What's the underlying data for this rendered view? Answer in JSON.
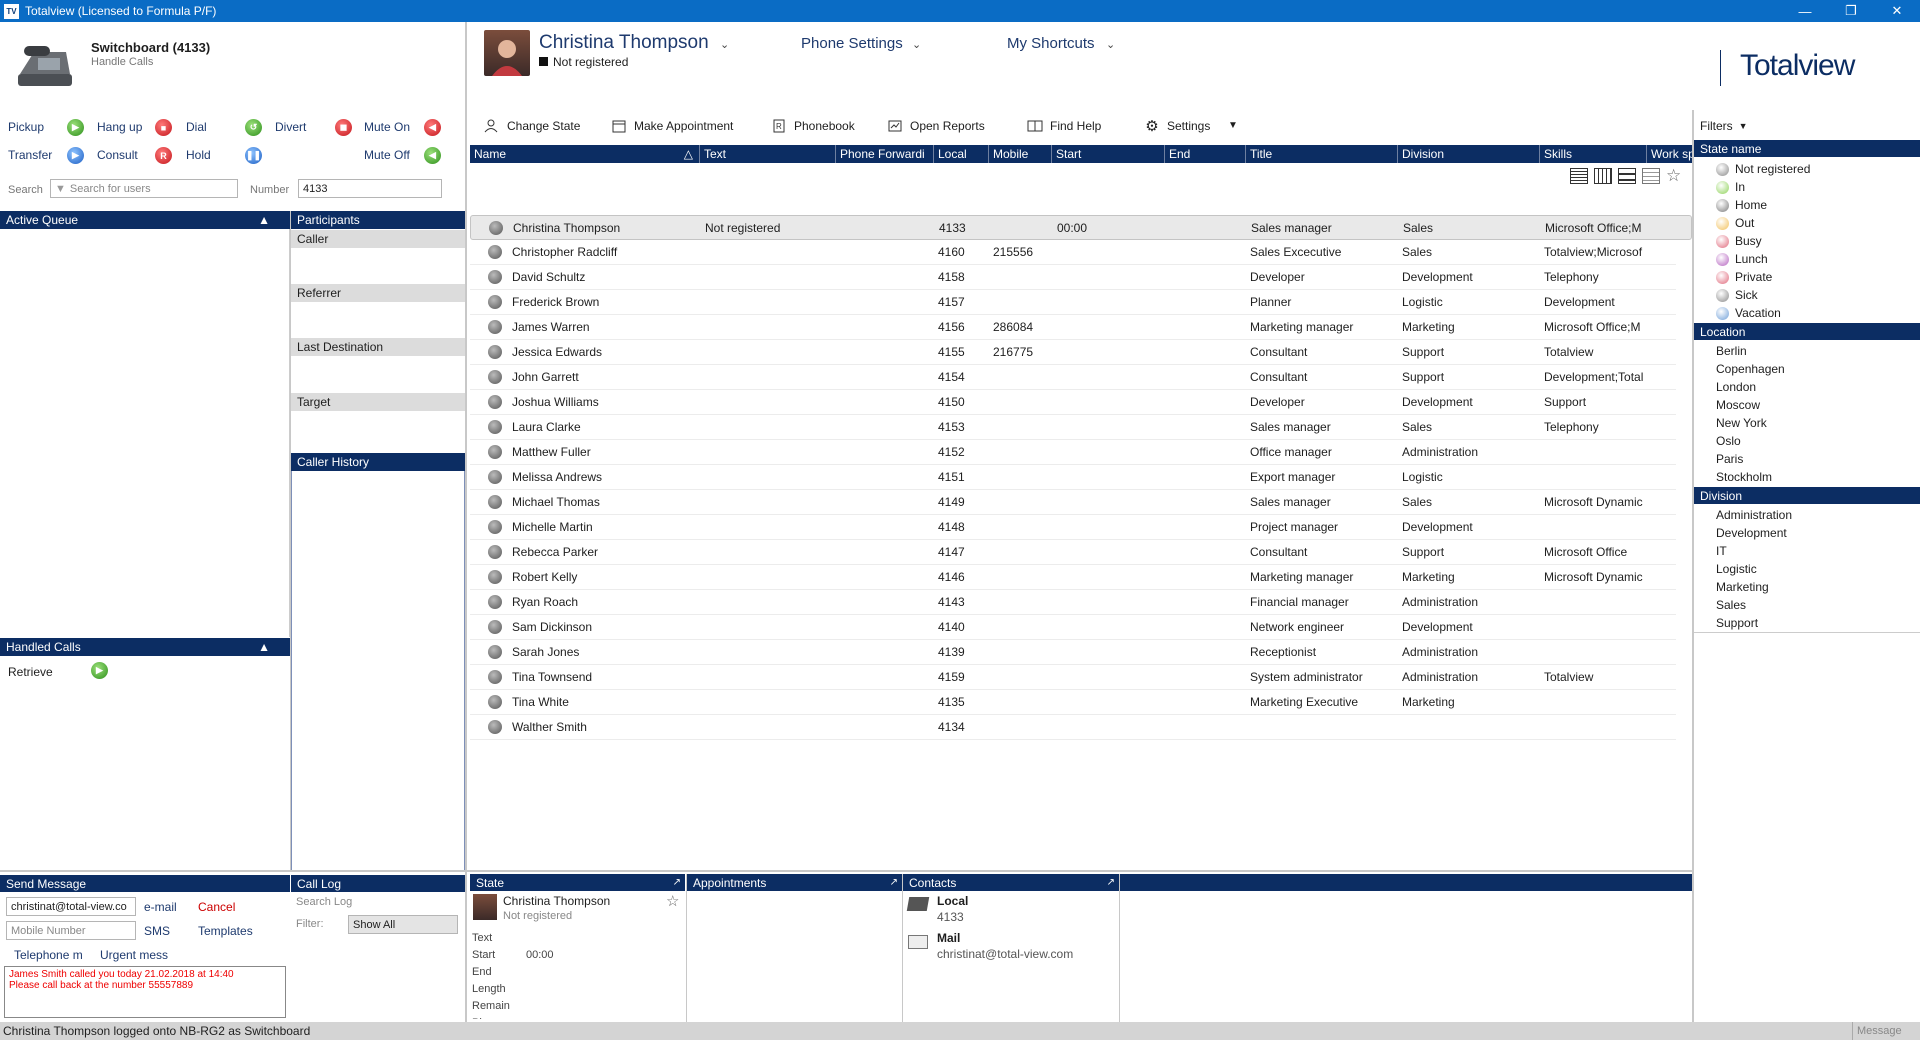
{
  "window": {
    "title": "Totalview  (Licensed to Formula P/F)",
    "app_badge": "TV"
  },
  "switchboard": {
    "title": "Switchboard (4133)",
    "subtitle": "Handle Calls"
  },
  "controls": {
    "pickup": "Pickup",
    "hangup": "Hang up",
    "dial": "Dial",
    "divert": "Divert",
    "mute_on": "Mute On",
    "transfer": "Transfer",
    "consult": "Consult",
    "hold": "Hold",
    "mute_off": "Mute Off"
  },
  "search": {
    "label": "Search",
    "placeholder": "Search for users",
    "number_label": "Number",
    "number_value": "4133"
  },
  "queue": {
    "active_queue": "Active Queue",
    "handled_calls": "Handled Calls",
    "retrieve": "Retrieve"
  },
  "participants": {
    "header": "Participants",
    "caller": "Caller",
    "referrer": "Referrer",
    "last_destination": "Last Destination",
    "target": "Target",
    "caller_history": "Caller History"
  },
  "header": {
    "user_name": "Christina Thompson",
    "user_status": "Not registered",
    "phone_settings": "Phone Settings",
    "my_shortcuts": "My Shortcuts",
    "logo": "Totalview"
  },
  "toolbar": {
    "change_state": "Change State",
    "make_appointment": "Make Appointment",
    "phonebook": "Phonebook",
    "open_reports": "Open Reports",
    "find_help": "Find Help",
    "settings": "Settings"
  },
  "table": {
    "columns": [
      "Name",
      "Text",
      "Phone Forwardi",
      "Local",
      "Mobile",
      "Start",
      "End",
      "Title",
      "Division",
      "Skills",
      "Work sp"
    ],
    "rows": [
      {
        "name": "Christina Thompson",
        "text": "Not registered",
        "local": "4133",
        "mobile": "",
        "start": "00:00",
        "title": "Sales manager",
        "division": "Sales",
        "skills": "Microsoft Office;M"
      },
      {
        "name": "Christopher Radcliff",
        "text": "",
        "local": "4160",
        "mobile": "215556",
        "start": "",
        "title": "Sales Excecutive",
        "division": "Sales",
        "skills": "Totalview;Microsof"
      },
      {
        "name": "David Schultz",
        "text": "",
        "local": "4158",
        "mobile": "",
        "start": "",
        "title": "Developer",
        "division": "Development",
        "skills": "Telephony"
      },
      {
        "name": "Frederick Brown",
        "text": "",
        "local": "4157",
        "mobile": "",
        "start": "",
        "title": "Planner",
        "division": "Logistic",
        "skills": "Development"
      },
      {
        "name": "James Warren",
        "text": "",
        "local": "4156",
        "mobile": "286084",
        "start": "",
        "title": "Marketing manager",
        "division": "Marketing",
        "skills": "Microsoft Office;M"
      },
      {
        "name": "Jessica Edwards",
        "text": "",
        "local": "4155",
        "mobile": "216775",
        "start": "",
        "title": "Consultant",
        "division": "Support",
        "skills": "Totalview"
      },
      {
        "name": "John Garrett",
        "text": "",
        "local": "4154",
        "mobile": "",
        "start": "",
        "title": "Consultant",
        "division": "Support",
        "skills": "Development;Total"
      },
      {
        "name": "Joshua Williams",
        "text": "",
        "local": "4150",
        "mobile": "",
        "start": "",
        "title": "Developer",
        "division": "Development",
        "skills": "Support"
      },
      {
        "name": "Laura Clarke",
        "text": "",
        "local": "4153",
        "mobile": "",
        "start": "",
        "title": "Sales manager",
        "division": "Sales",
        "skills": "Telephony"
      },
      {
        "name": "Matthew Fuller",
        "text": "",
        "local": "4152",
        "mobile": "",
        "start": "",
        "title": "Office manager",
        "division": "Administration",
        "skills": ""
      },
      {
        "name": "Melissa Andrews",
        "text": "",
        "local": "4151",
        "mobile": "",
        "start": "",
        "title": "Export manager",
        "division": "Logistic",
        "skills": ""
      },
      {
        "name": "Michael Thomas",
        "text": "",
        "local": "4149",
        "mobile": "",
        "start": "",
        "title": "Sales manager",
        "division": "Sales",
        "skills": "Microsoft Dynamic"
      },
      {
        "name": "Michelle Martin",
        "text": "",
        "local": "4148",
        "mobile": "",
        "start": "",
        "title": "Project manager",
        "division": "Development",
        "skills": ""
      },
      {
        "name": "Rebecca Parker",
        "text": "",
        "local": "4147",
        "mobile": "",
        "start": "",
        "title": "Consultant",
        "division": "Support",
        "skills": "Microsoft Office"
      },
      {
        "name": "Robert Kelly",
        "text": "",
        "local": "4146",
        "mobile": "",
        "start": "",
        "title": "Marketing manager",
        "division": "Marketing",
        "skills": "Microsoft Dynamic"
      },
      {
        "name": "Ryan Roach",
        "text": "",
        "local": "4143",
        "mobile": "",
        "start": "",
        "title": "Financial manager",
        "division": "Administration",
        "skills": ""
      },
      {
        "name": "Sam Dickinson",
        "text": "",
        "local": "4140",
        "mobile": "",
        "start": "",
        "title": "Network engineer",
        "division": "Development",
        "skills": ""
      },
      {
        "name": "Sarah Jones",
        "text": "",
        "local": "4139",
        "mobile": "",
        "start": "",
        "title": "Receptionist",
        "division": "Administration",
        "skills": ""
      },
      {
        "name": "Tina Townsend",
        "text": "",
        "local": "4159",
        "mobile": "",
        "start": "",
        "title": "System administrator",
        "division": "Administration",
        "skills": "Totalview"
      },
      {
        "name": "Tina White",
        "text": "",
        "local": "4135",
        "mobile": "",
        "start": "",
        "title": "Marketing Executive",
        "division": "Marketing",
        "skills": ""
      },
      {
        "name": "Walther Smith",
        "text": "",
        "local": "4134",
        "mobile": "",
        "start": "",
        "title": "",
        "division": "",
        "skills": ""
      }
    ]
  },
  "filters": {
    "title": "Filters",
    "state_header": "State name",
    "states": [
      {
        "label": "Not registered",
        "color": "#8a8a8a"
      },
      {
        "label": "In",
        "color": "#8fd35a"
      },
      {
        "label": "Home",
        "color": "#7b7b7b"
      },
      {
        "label": "Out",
        "color": "#f2c05a"
      },
      {
        "label": "Busy",
        "color": "#e06a7c"
      },
      {
        "label": "Lunch",
        "color": "#b564c0"
      },
      {
        "label": "Private",
        "color": "#e06a7c"
      },
      {
        "label": "Sick",
        "color": "#8a8a8a"
      },
      {
        "label": "Vacation",
        "color": "#6f9fd8"
      }
    ],
    "location_header": "Location",
    "locations": [
      "Berlin",
      "Copenhagen",
      "London",
      "Moscow",
      "New York",
      "Oslo",
      "Paris",
      "Stockholm"
    ],
    "division_header": "Division",
    "divisions": [
      "Administration",
      "Development",
      "IT",
      "Logistic",
      "Marketing",
      "Sales",
      "Support"
    ]
  },
  "send_message": {
    "header": "Send Message",
    "email_value": "christinat@total-view.co",
    "email_btn": "e-mail",
    "cancel": "Cancel",
    "mobile_placeholder": "Mobile Number",
    "sms": "SMS",
    "templates": "Templates",
    "tab_telephone": "Telephone m",
    "tab_urgent": "Urgent mess",
    "message": "James Smith called you today 21.02.2018 at 14:40\nPlease call back at the number 55557889"
  },
  "call_log": {
    "header": "Call Log",
    "search_placeholder": "Search Log",
    "filter_label": "Filter:",
    "filter_value": "Show All"
  },
  "state_panel": {
    "header": "State",
    "name": "Christina Thompson",
    "status": "Not registered",
    "text": "Text",
    "start": "Start",
    "start_value": "00:00",
    "end": "End",
    "length": "Length",
    "remain": "Remain",
    "phone": "Phone"
  },
  "appointments": {
    "header": "Appointments"
  },
  "contacts": {
    "header": "Contacts",
    "local_label": "Local",
    "local_value": "4133",
    "mail_label": "Mail",
    "mail_value": "christinat@total-view.com"
  },
  "statusbar": {
    "text": "Christina Thompson logged onto NB-RG2 as Switchboard",
    "right": "Message"
  }
}
